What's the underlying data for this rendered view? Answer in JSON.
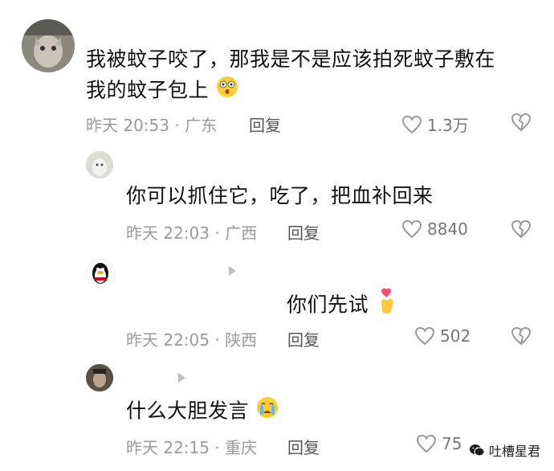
{
  "comments": [
    {
      "text_line1": "我被蚊子咬了，那我是不是应该拍死蚊子敷在",
      "text_line2": "我的蚊子包上",
      "time": "昨天 20:53 · 广东",
      "reply_label": "回复",
      "likes": "1.3万",
      "avatar_icon": "cat-avatar"
    },
    {
      "text": "你可以抓住它，吃了，把血补回来",
      "time": "昨天 22:03 · 广西",
      "reply_label": "回复",
      "likes": "8840",
      "avatar_icon": "dog-avatar"
    },
    {
      "text": "你们先试",
      "time": "昨天 22:05 · 陕西",
      "reply_label": "回复",
      "likes": "502",
      "avatar_icon": "penguin-avatar"
    },
    {
      "text": "什么大胆发言",
      "time": "昨天 22:15 · 重庆",
      "reply_label": "回复",
      "likes": "75",
      "avatar_icon": "person-avatar"
    }
  ],
  "watermark": {
    "text": "吐槽星君",
    "icon": "wechat-icon"
  },
  "colors": {
    "meta": "#9a9a9a",
    "text": "#111111",
    "icon": "#999999"
  }
}
